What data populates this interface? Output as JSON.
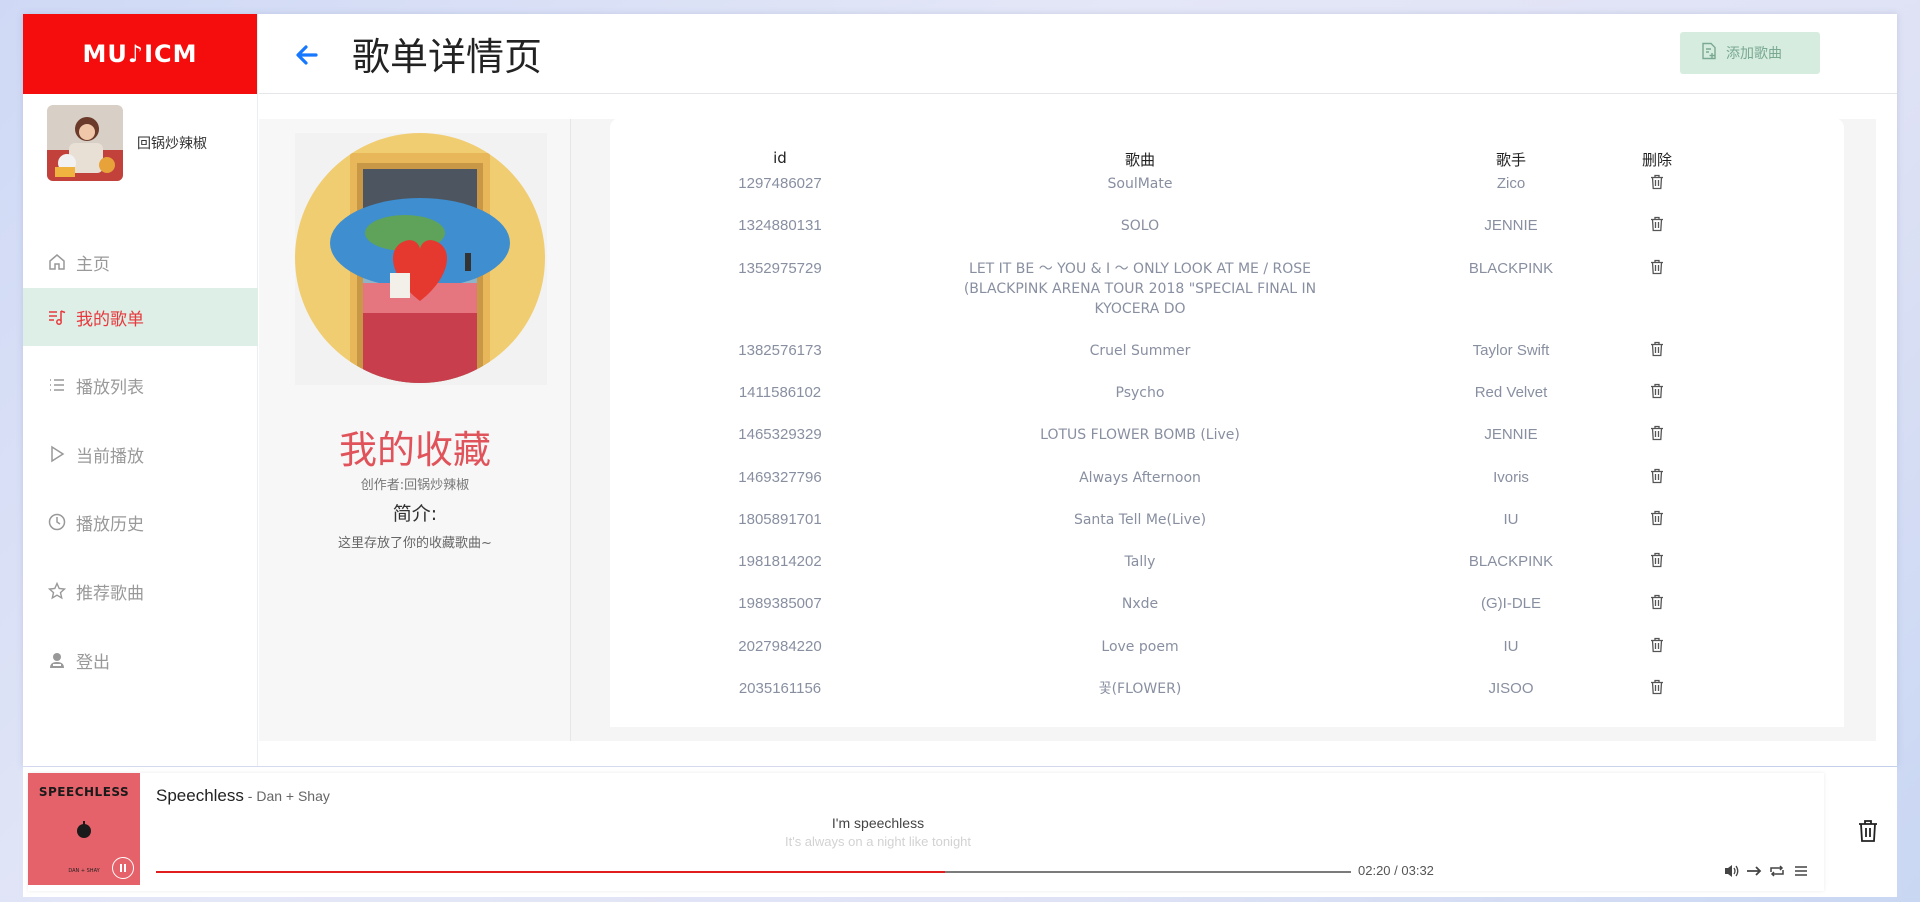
{
  "sidebar": {
    "logo_text": "MU♪ICM",
    "user_name": "回锅炒辣椒",
    "items": [
      {
        "label": "主页",
        "icon": "home-icon"
      },
      {
        "label": "我的歌单",
        "icon": "playlist-music-icon",
        "active": true
      },
      {
        "label": "播放列表",
        "icon": "list-icon"
      },
      {
        "label": "当前播放",
        "icon": "play-icon"
      },
      {
        "label": "播放历史",
        "icon": "clock-icon"
      },
      {
        "label": "推荐歌曲",
        "icon": "star-icon"
      },
      {
        "label": "登出",
        "icon": "logout-user-icon"
      }
    ]
  },
  "header": {
    "title": "歌单详情页",
    "add_button_label": "添加歌曲"
  },
  "playlist": {
    "title": "我的收藏",
    "creator": "创作者:回锅炒辣椒",
    "intro_heading": "简介:",
    "intro": "这里存放了你的收藏歌曲~"
  },
  "table": {
    "headers": {
      "id": "id",
      "song": "歌曲",
      "artist": "歌手",
      "delete": "删除"
    },
    "rows": [
      {
        "id": "1297486027",
        "song": "SoulMate",
        "artist": "Zico"
      },
      {
        "id": "1324880131",
        "song": "SOLO",
        "artist": "JENNIE"
      },
      {
        "id": "1352975729",
        "song": "LET IT BE ～ YOU & I ～ ONLY LOOK AT ME / ROSE (BLACKPINK ARENA TOUR 2018 \"SPECIAL FINAL IN KYOCERA DO",
        "artist": "BLACKPINK"
      },
      {
        "id": "1382576173",
        "song": "Cruel Summer",
        "artist": "Taylor Swift"
      },
      {
        "id": "1411586102",
        "song": "Psycho",
        "artist": "Red Velvet"
      },
      {
        "id": "1465329329",
        "song": "LOTUS FLOWER BOMB (Live)",
        "artist": "JENNIE"
      },
      {
        "id": "1469327796",
        "song": "Always Afternoon",
        "artist": "Ivoris"
      },
      {
        "id": "1805891701",
        "song": "Santa Tell Me(Live)",
        "artist": "IU"
      },
      {
        "id": "1981814202",
        "song": "Tally",
        "artist": "BLACKPINK"
      },
      {
        "id": "1989385007",
        "song": "Nxde",
        "artist": "(G)I-DLE"
      },
      {
        "id": "2027984220",
        "song": "Love poem",
        "artist": "IU"
      },
      {
        "id": "2035161156",
        "song": "꽃(FLOWER)",
        "artist": "JISOO"
      }
    ]
  },
  "player": {
    "cover_title": "SPEECHLESS",
    "cover_subtitle": "DAN + SHAY",
    "song": "Speechless",
    "artist_sep": " - Dan + Shay",
    "lyric_current": "I'm speechless",
    "lyric_next": "It's always on a night like tonight",
    "time": "02:20 / 03:32",
    "progress": 0.66
  },
  "colors": {
    "brand": "#f50c0c",
    "accent": "#e0535a",
    "active_bg": "#ddefe6",
    "add_button_bg": "#d6ecdf",
    "progress": "#e11d1d"
  }
}
